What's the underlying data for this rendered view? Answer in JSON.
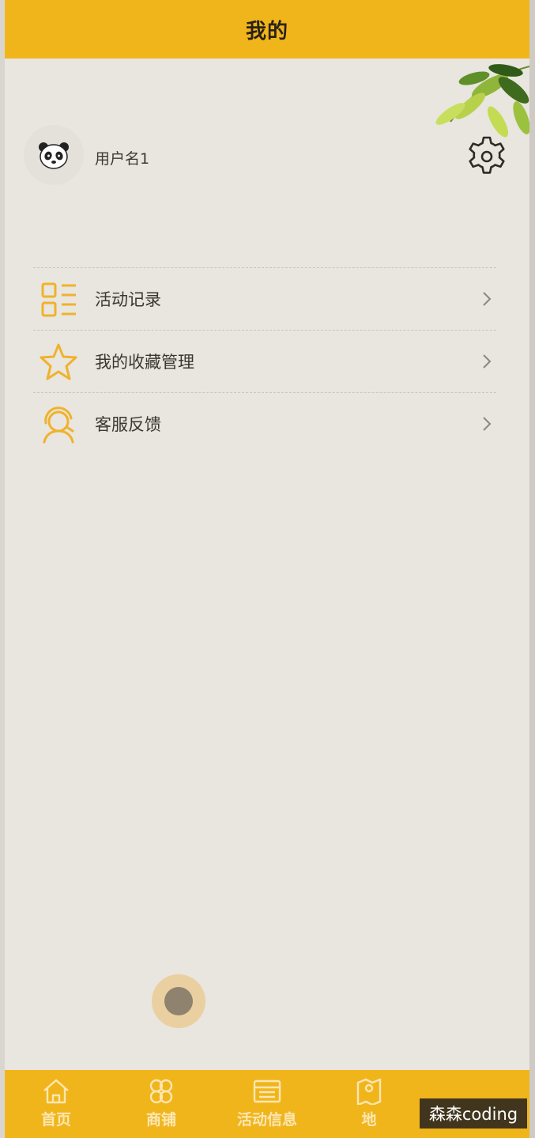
{
  "header": {
    "title": "我的"
  },
  "profile": {
    "avatar_icon": "panda-icon",
    "username": "用户名1",
    "settings_icon": "gear-icon"
  },
  "menu": {
    "items": [
      {
        "label": "活动记录",
        "icon": "list-icon"
      },
      {
        "label": "我的收藏管理",
        "icon": "star-icon"
      },
      {
        "label": "客服反馈",
        "icon": "headset-icon"
      }
    ]
  },
  "tabbar": {
    "items": [
      {
        "label": "首页",
        "icon": "home-icon"
      },
      {
        "label": "商铺",
        "icon": "shop-icon"
      },
      {
        "label": "活动信息",
        "icon": "calendar-icon"
      },
      {
        "label": "地",
        "icon": "map-icon"
      }
    ]
  },
  "watermark": "森森coding",
  "colors": {
    "accent": "#f1b51c",
    "background": "#e9e5df",
    "icon_accent": "#f0b22c"
  }
}
